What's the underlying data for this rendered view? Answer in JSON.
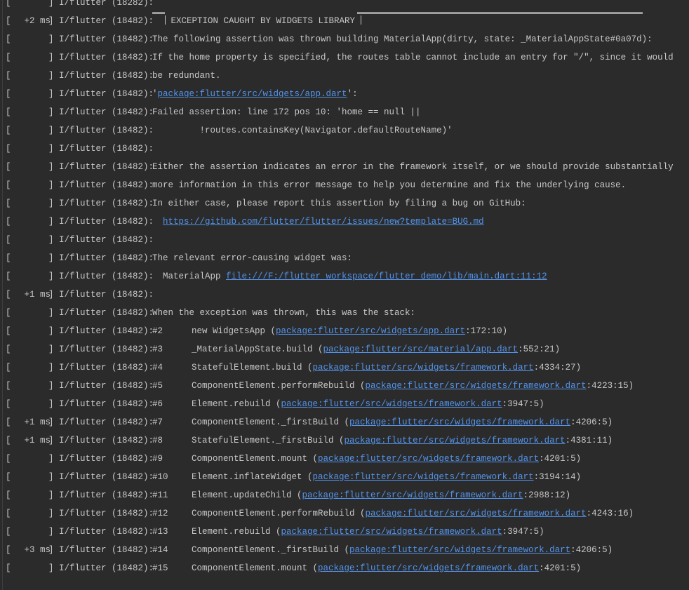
{
  "tag": "I/flutter",
  "rows": [
    {
      "open": "[",
      "time": "",
      "close": "]",
      "pid": "(18282):"
    },
    {
      "open": "[",
      "time": "+2 ms",
      "close": "]",
      "pid": "(18482):",
      "header": "EXCEPTION CAUGHT BY WIDGETS LIBRARY"
    },
    {
      "open": "[",
      "time": "",
      "close": "]",
      "pid": "(18482):",
      "text": "The following assertion was thrown building MaterialApp(dirty, state: _MaterialAppState#0a07d):"
    },
    {
      "open": "[",
      "time": "",
      "close": "]",
      "pid": "(18482):",
      "text": "If the home property is specified, the routes table cannot include an entry for \"/\", since it would"
    },
    {
      "open": "[",
      "time": "",
      "close": "]",
      "pid": "(18482):",
      "text": "be redundant."
    },
    {
      "open": "[",
      "time": "",
      "close": "]",
      "pid": "(18482):",
      "pre": "'",
      "link": "package:flutter/src/widgets/app.dart",
      "post": "':"
    },
    {
      "open": "[",
      "time": "",
      "close": "]",
      "pid": "(18482):",
      "text": "Failed assertion: line 172 pos 10: 'home == null ||"
    },
    {
      "open": "[",
      "time": "",
      "close": "]",
      "pid": "(18482):",
      "text": "         !routes.containsKey(Navigator.defaultRouteName)'"
    },
    {
      "open": "[",
      "time": "",
      "close": "]",
      "pid": "(18482):",
      "text": ""
    },
    {
      "open": "[",
      "time": "",
      "close": "]",
      "pid": "(18482):",
      "text": "Either the assertion indicates an error in the framework itself, or we should provide substantially"
    },
    {
      "open": "[",
      "time": "",
      "close": "]",
      "pid": "(18482):",
      "text": "more information in this error message to help you determine and fix the underlying cause."
    },
    {
      "open": "[",
      "time": "",
      "close": "]",
      "pid": "(18482):",
      "text": "In either case, please report this assertion by filing a bug on GitHub:"
    },
    {
      "open": "[",
      "time": "",
      "close": "]",
      "pid": "(18482):",
      "pre": "  ",
      "link": "https://github.com/flutter/flutter/issues/new?template=BUG.md",
      "post": ""
    },
    {
      "open": "[",
      "time": "",
      "close": "]",
      "pid": "(18482):",
      "text": ""
    },
    {
      "open": "[",
      "time": "",
      "close": "]",
      "pid": "(18482):",
      "text": "The relevant error-causing widget was:"
    },
    {
      "open": "[",
      "time": "",
      "close": "]",
      "pid": "(18482):",
      "pre": "  MaterialApp ",
      "link": "file:///F:/flutter_workspace/flutter_demo/lib/main.dart:11:12",
      "post": ""
    },
    {
      "open": "[",
      "time": "+1 ms",
      "close": "]",
      "pid": "(18482):",
      "text": ""
    },
    {
      "open": "[",
      "time": "",
      "close": "]",
      "pid": "(18482):",
      "text": "When the exception was thrown, this was the stack:"
    },
    {
      "open": "[",
      "time": "",
      "close": "]",
      "pid": "(18482):",
      "frame": "#2",
      "call": "new WidgetsApp (",
      "link": "package:flutter/src/widgets/app.dart",
      "post": ":172:10)"
    },
    {
      "open": "[",
      "time": "",
      "close": "]",
      "pid": "(18482):",
      "frame": "#3",
      "call": "_MaterialAppState.build (",
      "link": "package:flutter/src/material/app.dart",
      "post": ":552:21)"
    },
    {
      "open": "[",
      "time": "",
      "close": "]",
      "pid": "(18482):",
      "frame": "#4",
      "call": "StatefulElement.build (",
      "link": "package:flutter/src/widgets/framework.dart",
      "post": ":4334:27)"
    },
    {
      "open": "[",
      "time": "",
      "close": "]",
      "pid": "(18482):",
      "frame": "#5",
      "call": "ComponentElement.performRebuild (",
      "link": "package:flutter/src/widgets/framework.dart",
      "post": ":4223:15)"
    },
    {
      "open": "[",
      "time": "",
      "close": "]",
      "pid": "(18482):",
      "frame": "#6",
      "call": "Element.rebuild (",
      "link": "package:flutter/src/widgets/framework.dart",
      "post": ":3947:5)"
    },
    {
      "open": "[",
      "time": "+1 ms",
      "close": "]",
      "pid": "(18482):",
      "frame": "#7",
      "call": "ComponentElement._firstBuild (",
      "link": "package:flutter/src/widgets/framework.dart",
      "post": ":4206:5)"
    },
    {
      "open": "[",
      "time": "+1 ms",
      "close": "]",
      "pid": "(18482):",
      "frame": "#8",
      "call": "StatefulElement._firstBuild (",
      "link": "package:flutter/src/widgets/framework.dart",
      "post": ":4381:11)"
    },
    {
      "open": "[",
      "time": "",
      "close": "]",
      "pid": "(18482):",
      "frame": "#9",
      "call": "ComponentElement.mount (",
      "link": "package:flutter/src/widgets/framework.dart",
      "post": ":4201:5)"
    },
    {
      "open": "[",
      "time": "",
      "close": "]",
      "pid": "(18482):",
      "frame": "#10",
      "call": "Element.inflateWidget (",
      "link": "package:flutter/src/widgets/framework.dart",
      "post": ":3194:14)"
    },
    {
      "open": "[",
      "time": "",
      "close": "]",
      "pid": "(18482):",
      "frame": "#11",
      "call": "Element.updateChild (",
      "link": "package:flutter/src/widgets/framework.dart",
      "post": ":2988:12)"
    },
    {
      "open": "[",
      "time": "",
      "close": "]",
      "pid": "(18482):",
      "frame": "#12",
      "call": "ComponentElement.performRebuild (",
      "link": "package:flutter/src/widgets/framework.dart",
      "post": ":4243:16)"
    },
    {
      "open": "[",
      "time": "",
      "close": "]",
      "pid": "(18482):",
      "frame": "#13",
      "call": "Element.rebuild (",
      "link": "package:flutter/src/widgets/framework.dart",
      "post": ":3947:5)"
    },
    {
      "open": "[",
      "time": "+3 ms",
      "close": "]",
      "pid": "(18482):",
      "frame": "#14",
      "call": "ComponentElement._firstBuild (",
      "link": "package:flutter/src/widgets/framework.dart",
      "post": ":4206:5)"
    },
    {
      "open": "[",
      "time": "",
      "close": "]",
      "pid": "(18482):",
      "frame": "#15",
      "call": "ComponentElement.mount (",
      "link": "package:flutter/src/widgets/framework.dart",
      "post": ":4201:5)"
    }
  ]
}
